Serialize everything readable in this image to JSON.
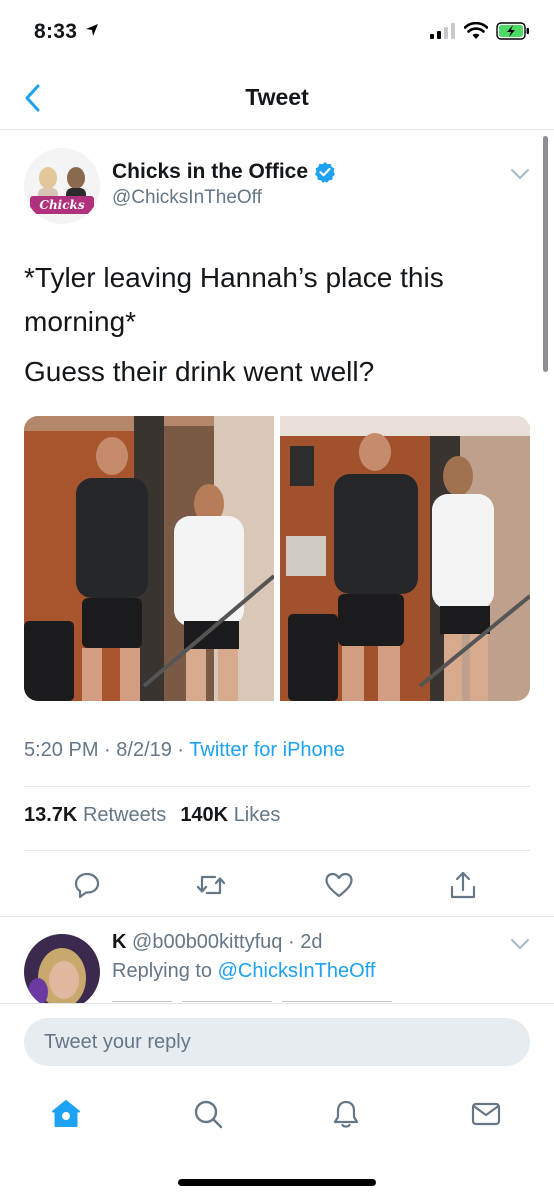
{
  "status_bar": {
    "time": "8:33"
  },
  "nav": {
    "title": "Tweet"
  },
  "tweet": {
    "author_name": "Chicks in the Office",
    "author_handle": "@ChicksInTheOff",
    "avatar_text": "Chicks",
    "text_line1": "*Tyler leaving Hannah’s place this morning*",
    "text_line2": "Guess their drink went well?",
    "time": "5:20 PM",
    "date": "8/2/19",
    "source": "Twitter for iPhone",
    "retweets_count": "13.7K",
    "retweets_label": "Retweets",
    "likes_count": "140K",
    "likes_label": "Likes"
  },
  "reply": {
    "name": "K",
    "handle": "@b00b00kittyfuq",
    "age": "2d",
    "replying_label": "Replying to",
    "replying_to": "@ChicksInTheOff"
  },
  "compose": {
    "placeholder": "Tweet your reply"
  },
  "colors": {
    "accent": "#1da1f2",
    "muted": "#657786",
    "text": "#14171a",
    "battery": "#4cd964"
  }
}
